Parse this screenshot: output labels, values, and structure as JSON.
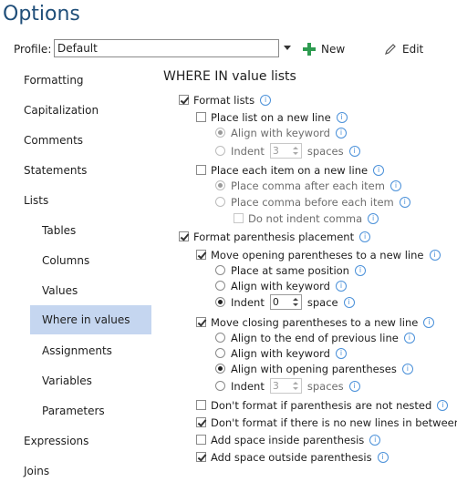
{
  "window": {
    "title": "Options"
  },
  "profile": {
    "label": "Profile:",
    "value": "Default",
    "new_label": "New",
    "edit_label": "Edit"
  },
  "nav": [
    "Formatting",
    "Capitalization",
    "Comments",
    "Statements",
    "Lists",
    "Tables",
    "Columns",
    "Values",
    "Where in values",
    "Assignments",
    "Variables",
    "Parameters",
    "Expressions",
    "Joins"
  ],
  "section": {
    "title": "WHERE IN value lists"
  },
  "options": {
    "format_lists": "Format lists",
    "place_list_new_line": "Place list on a new line",
    "align_keyword_1": "Align with keyword",
    "indent_1": "Indent",
    "indent_1_value": "3",
    "indent_1_unit": "spaces",
    "place_each_item_new_line": "Place each item on a new line",
    "comma_after": "Place comma after each item",
    "comma_before": "Place comma before each item",
    "no_indent_comma": "Do not indent comma",
    "format_parenthesis": "Format parenthesis placement",
    "move_opening": "Move opening parentheses to a new line",
    "same_position": "Place at same position",
    "align_keyword_2": "Align with keyword",
    "indent_2": "Indent",
    "indent_2_value": "0",
    "indent_2_unit": "space",
    "move_closing": "Move closing parentheses to a new line",
    "align_end_prev": "Align to the end of previous line",
    "align_keyword_3": "Align with keyword",
    "align_opening": "Align with opening parentheses",
    "indent_3": "Indent",
    "indent_3_value": "3",
    "indent_3_unit": "spaces",
    "not_nested": "Don't format if parenthesis are not nested",
    "no_new_lines": "Don't format if there is no new lines in between",
    "space_inside": "Add space inside parenthesis",
    "space_outside": "Add space outside parenthesis"
  },
  "colors": {
    "title": "#1f4e79",
    "nav_selected": "#c5d6f0",
    "new_icon": "#2e9b50",
    "info_icon": "#4a90d9"
  }
}
